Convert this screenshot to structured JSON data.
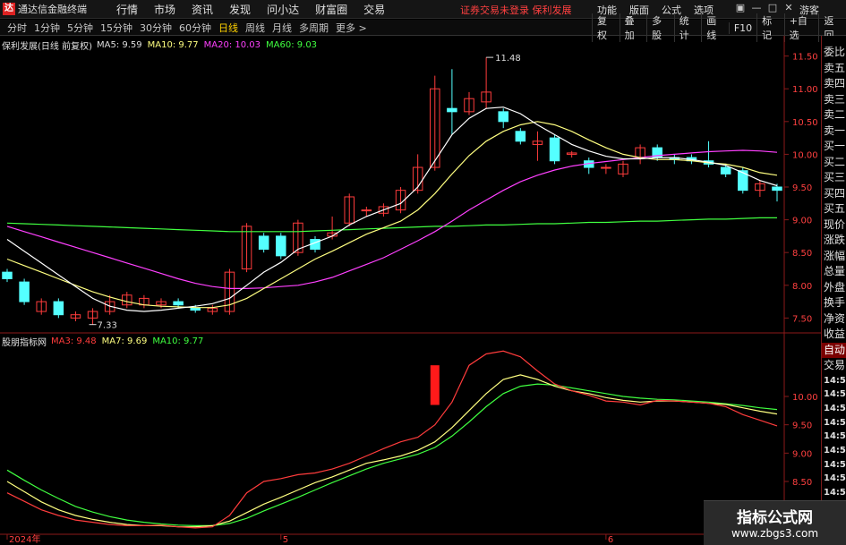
{
  "app": {
    "title": "通达信金融终端",
    "logo_glyph": "达"
  },
  "menu": [
    "行情",
    "市场",
    "资讯",
    "发现",
    "问小达",
    "财富圈",
    "交易"
  ],
  "warning": "证券交易未登录  保利发展",
  "right_menu": [
    "功能",
    "版面",
    "公式",
    "选项"
  ],
  "window_controls": [
    "▣",
    "—",
    "□",
    "✕"
  ],
  "guest": "游客",
  "periods": [
    "分时",
    "1分钟",
    "5分钟",
    "15分钟",
    "30分钟",
    "60分钟",
    "日线",
    "周线",
    "月线",
    "多周期",
    "更多 >"
  ],
  "active_period": "日线",
  "toolbar_right": [
    "复权",
    "叠加",
    "多股",
    "统计",
    "画线",
    "F10",
    "标记",
    "+自选",
    "返回"
  ],
  "ma_legend": {
    "title": "保利发展(日线 前复权)",
    "ma5": "MA5: 9.59",
    "ma10": "MA10: 9.77",
    "ma20": "MA20: 10.03",
    "ma60": "MA60: 9.03"
  },
  "sub_legend": {
    "title": "股朋指标网",
    "ma3": "MA3: 9.48",
    "ma7": "MA7: 9.69",
    "ma10": "MA10: 9.77"
  },
  "annotations": {
    "high": "11.48",
    "low": "7.33"
  },
  "right_panel": [
    "委比",
    "卖五",
    "卖四",
    "卖三",
    "卖二",
    "卖一",
    "买一",
    "买二",
    "买三",
    "买四",
    "买五",
    "现价",
    "涨跌",
    "涨幅",
    "总量",
    "外盘",
    "换手",
    "净资",
    "收益"
  ],
  "right_panel_bottom": [
    "自动",
    "交易"
  ],
  "right_panel_times": [
    "14:56",
    "14:56",
    "14:56",
    "14:56",
    "14:56",
    "14:56",
    "14:56",
    "14:56",
    "14:56",
    "14:56"
  ],
  "colors": {
    "up": "#ff3c3c",
    "down": "#54ffff",
    "ma5": "#ffffff",
    "ma10": "#ffff80",
    "ma20": "#ff40ff",
    "ma60": "#40ff40",
    "sub_ma3": "#ff3c3c",
    "sub_ma7": "#ffff80",
    "sub_ma10": "#40ff40"
  },
  "watermark": {
    "title": "指标公式网",
    "url": "www.zbgs3.com"
  },
  "chart_data": [
    {
      "type": "candlestick",
      "ylim": [
        7.3,
        11.7
      ],
      "yticks": [
        7.5,
        8.0,
        8.5,
        9.0,
        9.5,
        10.0,
        10.5,
        11.0,
        11.5
      ],
      "xticks": [
        {
          "label": "2024年",
          "index": 0
        },
        {
          "label": "5",
          "index": 16
        },
        {
          "label": "6",
          "index": 35
        }
      ],
      "candles": [
        [
          8.2,
          8.1,
          8.25,
          8.05
        ],
        [
          8.05,
          7.75,
          8.1,
          7.7
        ],
        [
          7.6,
          7.75,
          7.8,
          7.55
        ],
        [
          7.75,
          7.55,
          7.8,
          7.5
        ],
        [
          7.5,
          7.55,
          7.6,
          7.45
        ],
        [
          7.5,
          7.6,
          7.65,
          7.4
        ],
        [
          7.6,
          7.75,
          7.85,
          7.55
        ],
        [
          7.7,
          7.85,
          7.9,
          7.65
        ],
        [
          7.7,
          7.8,
          7.85,
          7.65
        ],
        [
          7.7,
          7.75,
          7.8,
          7.65
        ],
        [
          7.75,
          7.7,
          7.8,
          7.65
        ],
        [
          7.65,
          7.62,
          7.7,
          7.58
        ],
        [
          7.6,
          7.65,
          7.7,
          7.55
        ],
        [
          7.6,
          8.2,
          8.25,
          7.55
        ],
        [
          8.25,
          8.9,
          8.95,
          8.2
        ],
        [
          8.75,
          8.55,
          8.8,
          8.5
        ],
        [
          8.75,
          8.45,
          8.8,
          8.4
        ],
        [
          8.5,
          8.95,
          9.0,
          8.45
        ],
        [
          8.7,
          8.55,
          8.75,
          8.5
        ],
        [
          8.75,
          8.8,
          9.05,
          8.7
        ],
        [
          8.95,
          9.35,
          9.4,
          8.9
        ],
        [
          9.15,
          9.15,
          9.2,
          9.05
        ],
        [
          9.1,
          9.2,
          9.25,
          9.05
        ],
        [
          9.15,
          9.45,
          9.5,
          9.1
        ],
        [
          9.45,
          9.8,
          10.0,
          9.4
        ],
        [
          9.8,
          11.0,
          11.2,
          9.75
        ],
        [
          10.7,
          10.65,
          11.3,
          10.3
        ],
        [
          10.65,
          10.85,
          10.95,
          10.6
        ],
        [
          10.8,
          10.95,
          11.48,
          10.7
        ],
        [
          10.65,
          10.5,
          10.7,
          10.4
        ],
        [
          10.35,
          10.2,
          10.4,
          10.15
        ],
        [
          10.15,
          10.2,
          10.35,
          9.9
        ],
        [
          10.25,
          9.9,
          10.3,
          9.85
        ],
        [
          10.0,
          10.02,
          10.05,
          9.95
        ],
        [
          9.9,
          9.8,
          9.95,
          9.7
        ],
        [
          9.8,
          9.8,
          9.85,
          9.7
        ],
        [
          9.7,
          9.85,
          9.9,
          9.65
        ],
        [
          9.95,
          10.1,
          10.15,
          9.85
        ],
        [
          10.1,
          9.95,
          10.15,
          9.9
        ],
        [
          9.95,
          9.92,
          10.0,
          9.85
        ],
        [
          9.95,
          9.9,
          10.0,
          9.85
        ],
        [
          9.9,
          9.85,
          10.2,
          9.8
        ],
        [
          9.8,
          9.7,
          9.85,
          9.65
        ],
        [
          9.75,
          9.45,
          9.8,
          9.4
        ],
        [
          9.45,
          9.55,
          9.6,
          9.35
        ],
        [
          9.5,
          9.45,
          9.55,
          9.28
        ]
      ],
      "ma_lines": {
        "ma5": [
          8.7,
          8.52,
          8.34,
          8.16,
          7.98,
          7.8,
          7.68,
          7.62,
          7.6,
          7.62,
          7.65,
          7.68,
          7.72,
          7.8,
          8.0,
          8.2,
          8.35,
          8.55,
          8.65,
          8.75,
          8.92,
          9.05,
          9.15,
          9.25,
          9.5,
          9.9,
          10.3,
          10.55,
          10.7,
          10.72,
          10.62,
          10.45,
          10.3,
          10.15,
          10.05,
          9.97,
          9.93,
          9.93,
          9.95,
          9.95,
          9.92,
          9.88,
          9.83,
          9.72,
          9.6,
          9.52
        ],
        "ma10": [
          8.4,
          8.3,
          8.2,
          8.1,
          8.0,
          7.9,
          7.82,
          7.75,
          7.7,
          7.68,
          7.67,
          7.66,
          7.66,
          7.7,
          7.8,
          7.95,
          8.1,
          8.25,
          8.4,
          8.52,
          8.65,
          8.78,
          8.88,
          8.98,
          9.15,
          9.4,
          9.7,
          9.98,
          10.2,
          10.35,
          10.45,
          10.5,
          10.45,
          10.35,
          10.22,
          10.1,
          10.0,
          9.95,
          9.92,
          9.92,
          9.9,
          9.87,
          9.85,
          9.8,
          9.72,
          9.68
        ],
        "ma20": [
          8.9,
          8.82,
          8.74,
          8.66,
          8.58,
          8.5,
          8.42,
          8.34,
          8.26,
          8.18,
          8.1,
          8.03,
          7.98,
          7.95,
          7.95,
          7.96,
          7.98,
          8.0,
          8.05,
          8.12,
          8.22,
          8.32,
          8.42,
          8.55,
          8.68,
          8.82,
          8.98,
          9.15,
          9.3,
          9.45,
          9.58,
          9.68,
          9.76,
          9.82,
          9.86,
          9.89,
          9.92,
          9.95,
          9.98,
          10.0,
          10.02,
          10.04,
          10.05,
          10.06,
          10.05,
          10.03
        ],
        "ma60": [
          8.95,
          8.94,
          8.93,
          8.92,
          8.91,
          8.9,
          8.89,
          8.88,
          8.87,
          8.86,
          8.85,
          8.84,
          8.83,
          8.82,
          8.82,
          8.82,
          8.82,
          8.82,
          8.83,
          8.84,
          8.85,
          8.86,
          8.87,
          8.88,
          8.89,
          8.9,
          8.9,
          8.91,
          8.92,
          8.92,
          8.93,
          8.94,
          8.94,
          8.95,
          8.96,
          8.96,
          8.97,
          8.98,
          8.98,
          8.99,
          9.0,
          9.01,
          9.01,
          9.02,
          9.03,
          9.03
        ]
      }
    },
    {
      "type": "line",
      "ylim": [
        7.6,
        10.9
      ],
      "yticks": [
        8.0,
        8.5,
        9.0,
        9.5,
        10.0
      ],
      "series": [
        {
          "name": "MA3",
          "values": [
            8.3,
            8.15,
            8.0,
            7.9,
            7.82,
            7.78,
            7.74,
            7.72,
            7.72,
            7.73,
            7.7,
            7.68,
            7.7,
            7.9,
            8.3,
            8.5,
            8.55,
            8.62,
            8.65,
            8.72,
            8.82,
            8.95,
            9.08,
            9.2,
            9.28,
            9.5,
            9.9,
            10.55,
            10.75,
            10.8,
            10.7,
            10.45,
            10.22,
            10.1,
            10.02,
            9.92,
            9.9,
            9.85,
            9.93,
            9.92,
            9.9,
            9.88,
            9.82,
            9.68,
            9.58,
            9.48
          ]
        },
        {
          "name": "MA7",
          "values": [
            8.5,
            8.32,
            8.14,
            8.0,
            7.9,
            7.83,
            7.78,
            7.74,
            7.72,
            7.72,
            7.7,
            7.7,
            7.72,
            7.8,
            7.95,
            8.1,
            8.22,
            8.35,
            8.48,
            8.58,
            8.7,
            8.82,
            8.88,
            8.95,
            9.05,
            9.2,
            9.45,
            9.75,
            10.05,
            10.3,
            10.38,
            10.3,
            10.18,
            10.1,
            10.05,
            9.98,
            9.93,
            9.9,
            9.92,
            9.92,
            9.9,
            9.88,
            9.86,
            9.8,
            9.74,
            9.69
          ]
        },
        {
          "name": "MA10",
          "values": [
            8.7,
            8.52,
            8.35,
            8.2,
            8.06,
            7.96,
            7.88,
            7.82,
            7.78,
            7.75,
            7.73,
            7.72,
            7.72,
            7.76,
            7.85,
            7.98,
            8.1,
            8.22,
            8.35,
            8.48,
            8.6,
            8.72,
            8.82,
            8.9,
            8.98,
            9.1,
            9.3,
            9.55,
            9.82,
            10.05,
            10.18,
            10.22,
            10.2,
            10.15,
            10.1,
            10.05,
            10.0,
            9.97,
            9.95,
            9.94,
            9.92,
            9.9,
            9.87,
            9.84,
            9.8,
            9.77
          ]
        }
      ],
      "signal_bar": {
        "index": 25,
        "from": 10.55,
        "to": 9.85
      }
    }
  ]
}
